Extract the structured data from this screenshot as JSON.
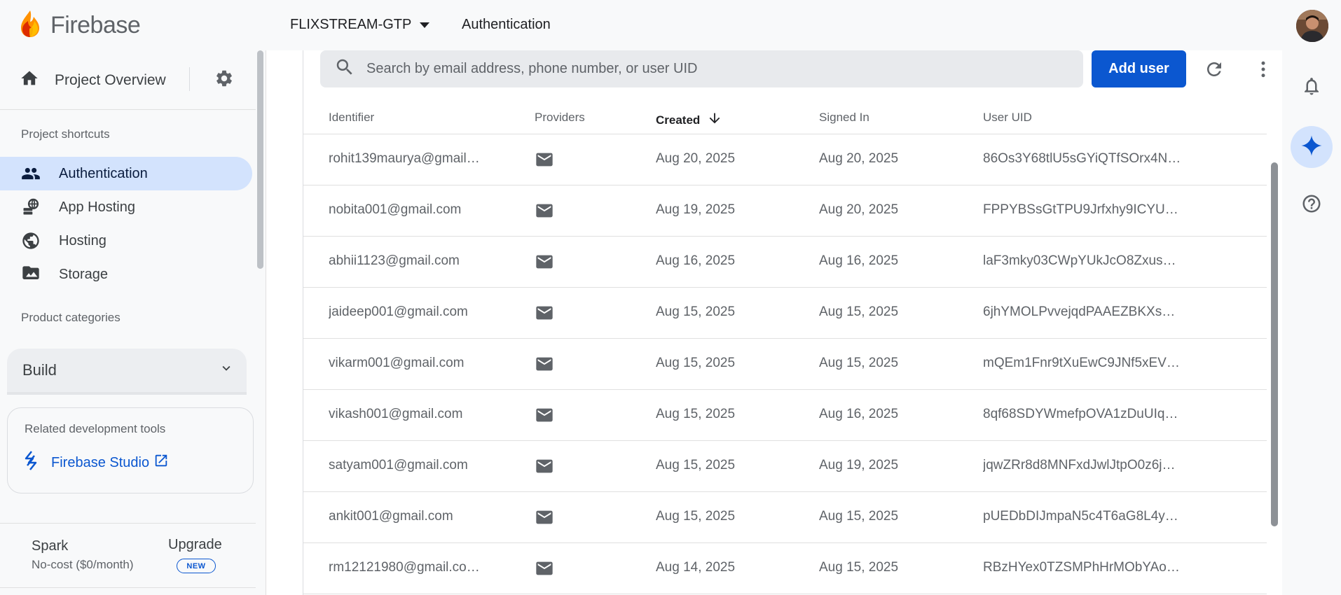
{
  "header": {
    "brand": "Firebase",
    "project_name": "FLIXSTREAM-GTP",
    "current_page": "Authentication"
  },
  "sidebar": {
    "overview_label": "Project Overview",
    "shortcuts_title": "Project shortcuts",
    "items": [
      {
        "label": "Authentication",
        "icon": "people-icon",
        "active": true
      },
      {
        "label": "App Hosting",
        "icon": "app-hosting-icon",
        "active": false
      },
      {
        "label": "Hosting",
        "icon": "globe-icon",
        "active": false
      },
      {
        "label": "Storage",
        "icon": "image-folder-icon",
        "active": false
      }
    ],
    "categories_title": "Product categories",
    "build_label": "Build",
    "tools": {
      "title": "Related development tools",
      "studio_label": "Firebase Studio"
    },
    "plan": {
      "name": "Spark",
      "description": "No-cost ($0/month)",
      "upgrade_label": "Upgrade",
      "badge": "NEW"
    }
  },
  "search": {
    "placeholder": "Search by email address, phone number, or user UID"
  },
  "toolbar": {
    "add_user_label": "Add user"
  },
  "table": {
    "columns": [
      "Identifier",
      "Providers",
      "Created",
      "Signed In",
      "User UID"
    ],
    "sorted_column": "Created",
    "rows": [
      {
        "identifier": "rohit139maurya@gmail…",
        "provider": "email-icon",
        "created": "Aug 20, 2025",
        "signed_in": "Aug 20, 2025",
        "uid": "86Os3Y68tlU5sGYiQTfSOrx4N…"
      },
      {
        "identifier": "nobita001@gmail.com",
        "provider": "email-icon",
        "created": "Aug 19, 2025",
        "signed_in": "Aug 20, 2025",
        "uid": "FPPYBSsGtTPU9Jrfxhy9ICYU…"
      },
      {
        "identifier": "abhii1123@gmail.com",
        "provider": "email-icon",
        "created": "Aug 16, 2025",
        "signed_in": "Aug 16, 2025",
        "uid": "laF3mky03CWpYUkJcO8Zxus…"
      },
      {
        "identifier": "jaideep001@gmail.com",
        "provider": "email-icon",
        "created": "Aug 15, 2025",
        "signed_in": "Aug 15, 2025",
        "uid": "6jhYMOLPvvejqdPAAEZBKXs…"
      },
      {
        "identifier": "vikarm001@gmail.com",
        "provider": "email-icon",
        "created": "Aug 15, 2025",
        "signed_in": "Aug 15, 2025",
        "uid": "mQEm1Fnr9tXuEwC9JNf5xEV…"
      },
      {
        "identifier": "vikash001@gmail.com",
        "provider": "email-icon",
        "created": "Aug 15, 2025",
        "signed_in": "Aug 16, 2025",
        "uid": "8qf68SDYWmefpOVA1zDuUIq…"
      },
      {
        "identifier": "satyam001@gmail.com",
        "provider": "email-icon",
        "created": "Aug 15, 2025",
        "signed_in": "Aug 19, 2025",
        "uid": "jqwZRr8d8MNFxdJwlJtpO0z6j…"
      },
      {
        "identifier": "ankit001@gmail.com",
        "provider": "email-icon",
        "created": "Aug 15, 2025",
        "signed_in": "Aug 15, 2025",
        "uid": "pUEDbDIJmpaN5c4T6aG8L4y…"
      },
      {
        "identifier": "rm12121980@gmail.co…",
        "provider": "email-icon",
        "created": "Aug 14, 2025",
        "signed_in": "Aug 15, 2025",
        "uid": "RBzHYex0TZSMPhHrMObYAo…"
      }
    ]
  },
  "rail": {
    "icons": [
      "avatar",
      "bell-icon",
      "gemini-sparkle-icon",
      "help-icon"
    ]
  },
  "colors": {
    "accent": "#0b57d0",
    "active_nav": "#d3e3fd",
    "firebase_orange": "#ff9100"
  }
}
